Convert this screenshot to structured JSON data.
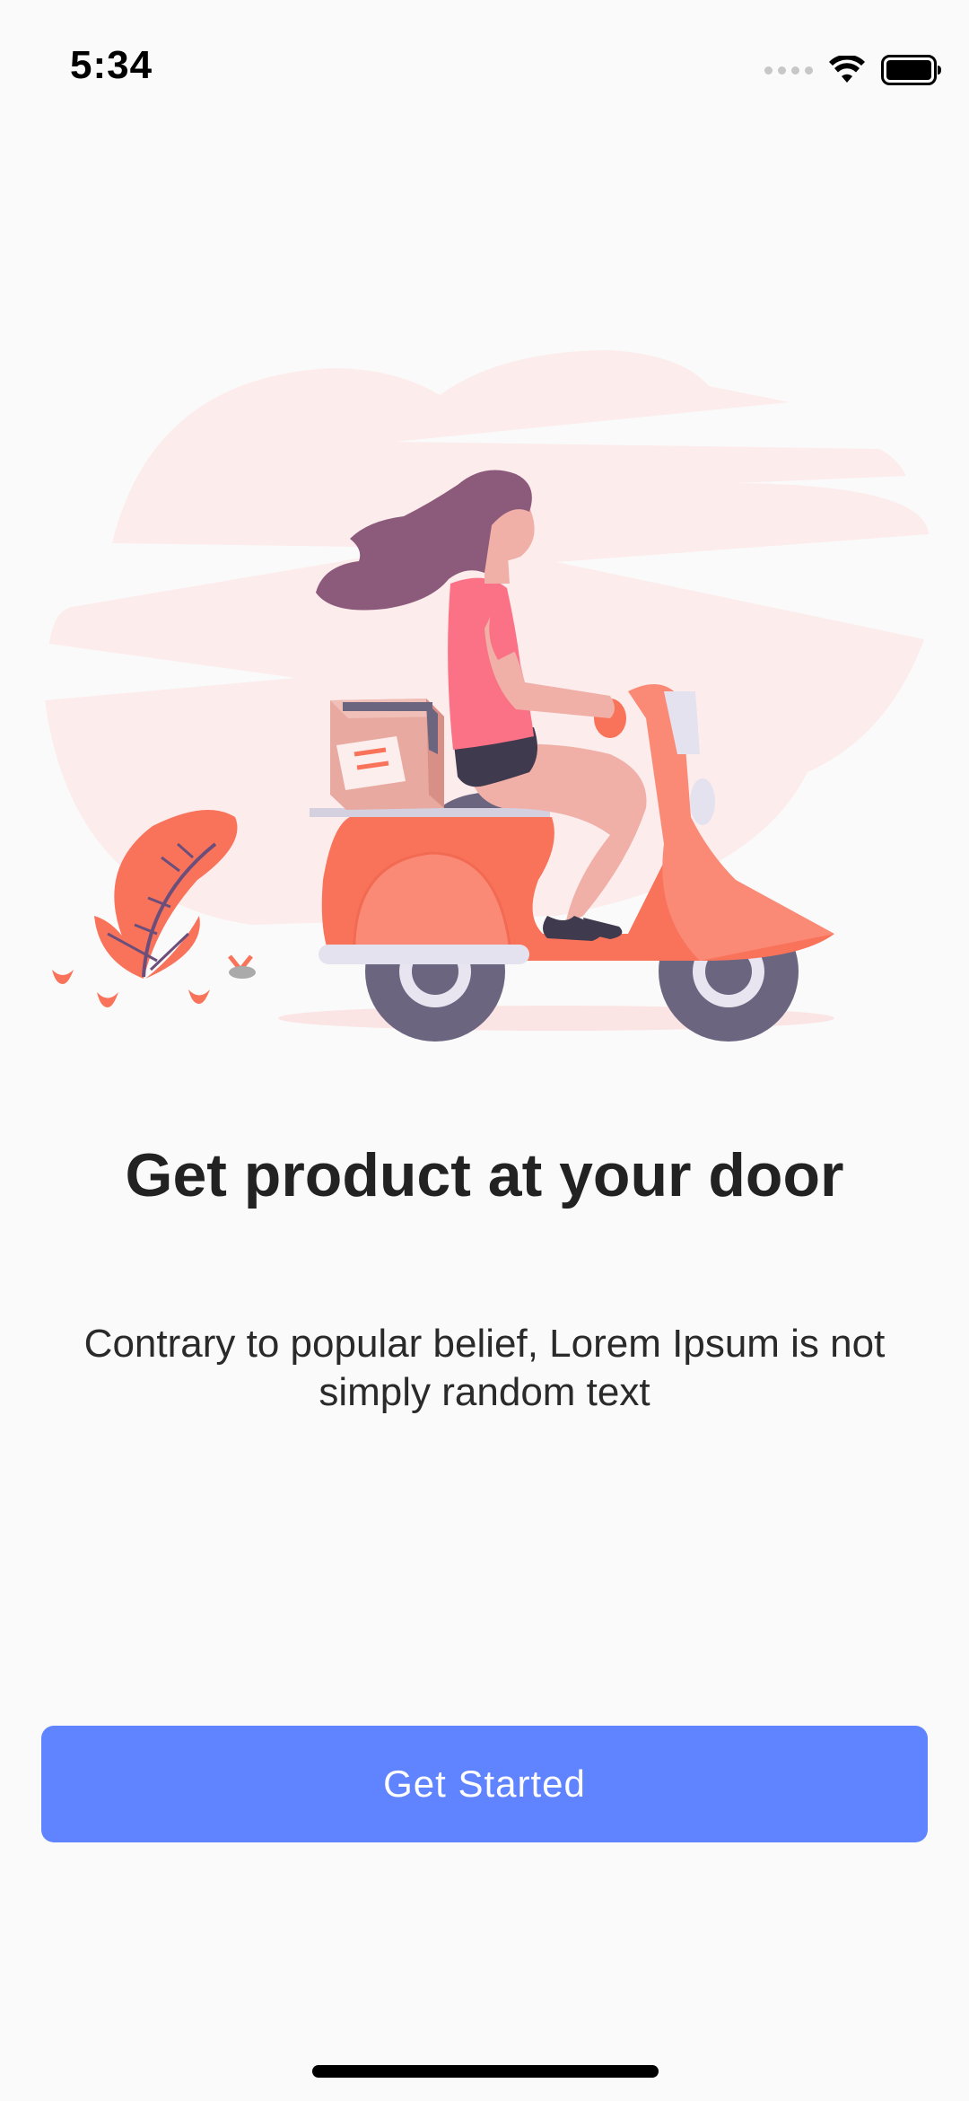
{
  "status_bar": {
    "time": "5:34",
    "icons": [
      "cellular-signal-icon",
      "wifi-icon",
      "battery-icon"
    ]
  },
  "illustration": {
    "name": "delivery-scooter-illustration",
    "colors": {
      "cloud": "#fdecec",
      "scooter": "#f9735b",
      "scooter_light": "#fa8a76",
      "hair": "#8c5a7a",
      "shirt": "#fb7185",
      "skin": "#f0b0a8",
      "wheel": "#6b6580",
      "box": "#e8a9a0",
      "plant": "#f9735b"
    }
  },
  "onboarding": {
    "title": "Get product at your door",
    "subtitle": "Contrary to popular belief, Lorem Ipsum is not simply random text",
    "button_label": "Get Started"
  },
  "colors": {
    "accent": "#6084ff",
    "background": "#fafafa",
    "text": "#222222"
  }
}
